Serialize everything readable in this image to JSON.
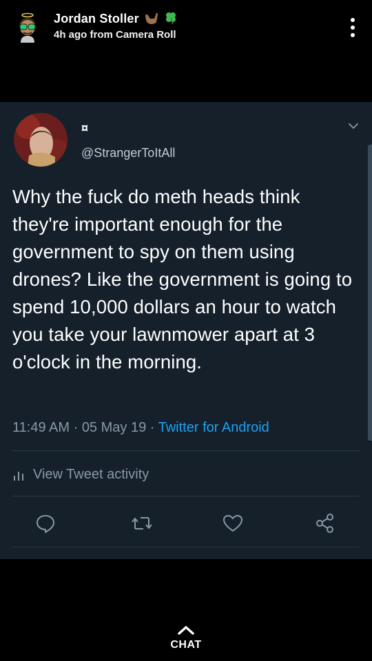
{
  "story": {
    "username": "Jordan Stoller",
    "username_emojis": [
      "call-me-hand",
      "four-leaf-clover"
    ],
    "subtitle": "4h ago from Camera Roll",
    "avatar_icon": "bitmoji-avatar",
    "more_icon": "more-vertical-icon"
  },
  "tweet": {
    "display_name": "¤",
    "handle": "@StrangerToItAll",
    "text": "Why the fuck do meth heads think they're important enough for the government to spy on them using drones? Like the government is going to spend 10,000 dollars an hour to watch you take your lawnmower apart at 3 o'clock in the morning.",
    "time": "11:49 AM",
    "date": "05 May 19",
    "source": "Twitter for Android",
    "activity_label": "View Tweet activity",
    "colors": {
      "background": "#15202b",
      "accent": "#1da1f2",
      "muted": "#8899a6"
    }
  },
  "chat": {
    "label": "CHAT"
  }
}
